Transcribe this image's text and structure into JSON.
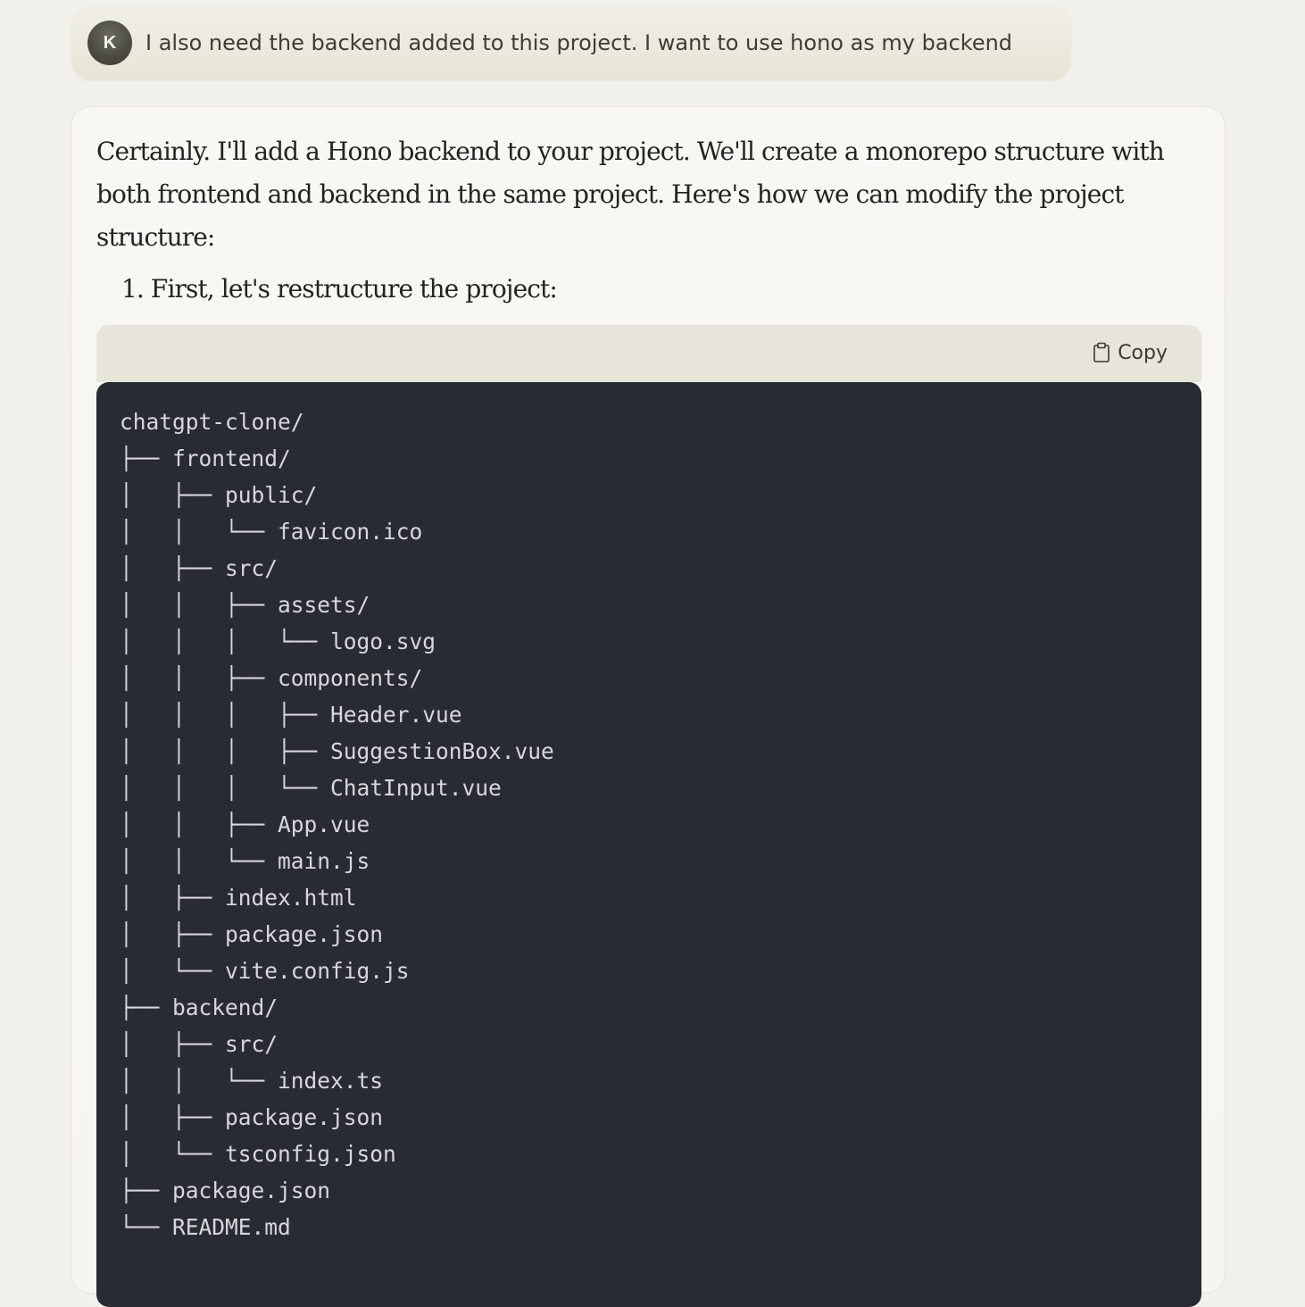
{
  "user_message": {
    "avatar_initial": "K",
    "text": "I also need the backend added to this project. I want to use hono as my backend"
  },
  "assistant_message": {
    "intro": "Certainly. I'll add a Hono backend to your project. We'll create a monorepo structure with both frontend and backend in the same project. Here's how we can modify the project structure:",
    "step_1": "1. First, let's restructure the project:",
    "code_block": {
      "copy_label": "Copy",
      "copy_icon": "clipboard-icon",
      "content": "chatgpt-clone/\n├── frontend/\n│   ├── public/\n│   │   └── favicon.ico\n│   ├── src/\n│   │   ├── assets/\n│   │   │   └── logo.svg\n│   │   ├── components/\n│   │   │   ├── Header.vue\n│   │   │   ├── SuggestionBox.vue\n│   │   │   └── ChatInput.vue\n│   │   ├── App.vue\n│   │   └── main.js\n│   ├── index.html\n│   ├── package.json\n│   └── vite.config.js\n├── backend/\n│   ├── src/\n│   │   └── index.ts\n│   ├── package.json\n│   └── tsconfig.json\n├── package.json\n└── README.md"
    }
  },
  "colors": {
    "page_background": "#f1f0ea",
    "user_bubble": "#eceadf",
    "avatar": "#4b4a42",
    "code_background": "#282b33",
    "code_header": "#e7e5da",
    "code_text": "#d7d8dc"
  }
}
